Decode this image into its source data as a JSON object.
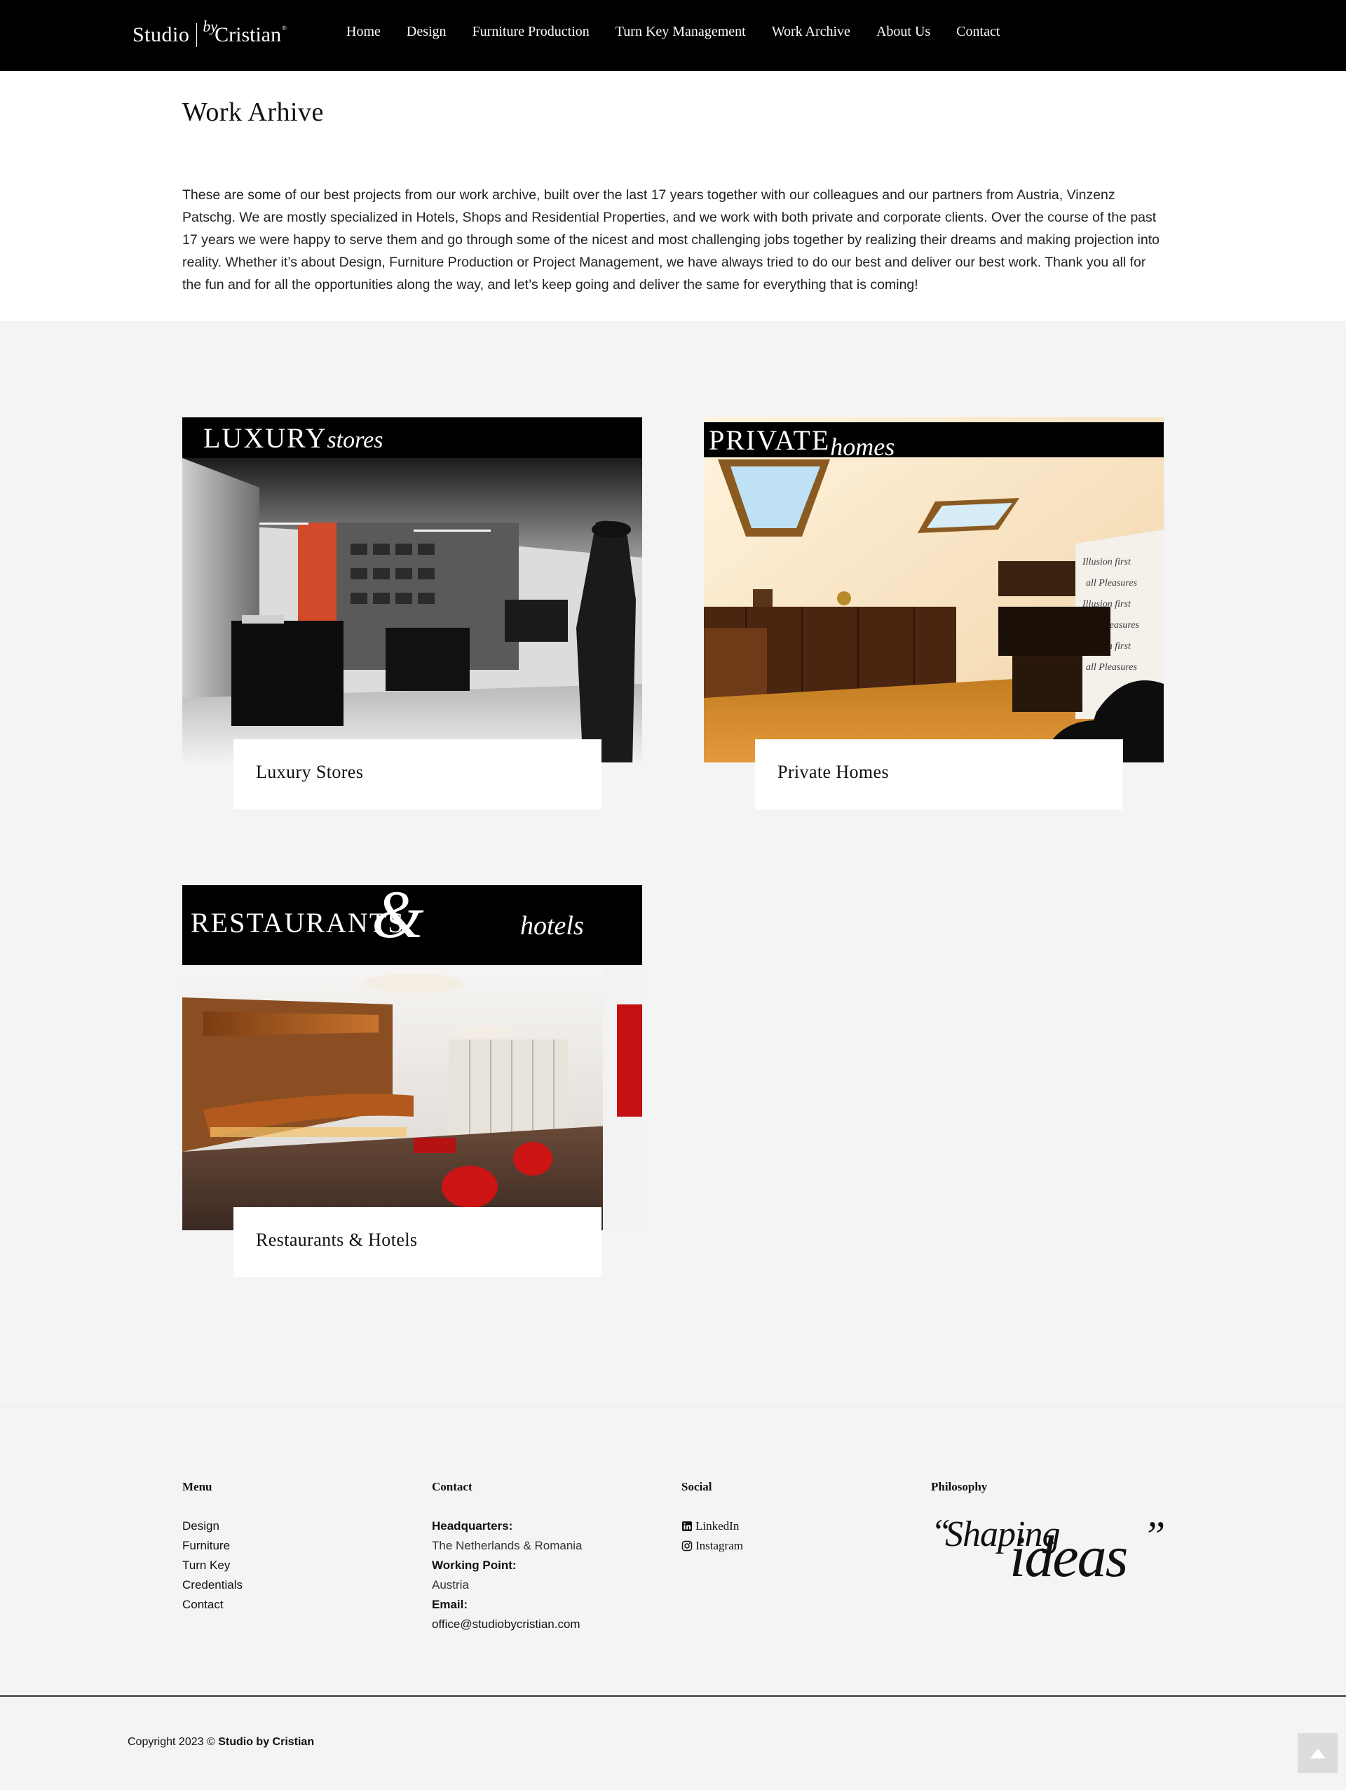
{
  "header": {
    "logo": {
      "studio": "Studio",
      "by": "by",
      "name": "Cristian",
      "reg": "®"
    },
    "nav": [
      "Home",
      "Design",
      "Furniture Production",
      "Turn Key Management",
      "Work Archive",
      "About Us",
      "Contact"
    ]
  },
  "intro": {
    "title": "Work Arhive",
    "text": "These are some of our best projects from our work archive, built over the last 17 years together with our colleagues and our partners from Austria, Vinzenz Patschg. We are mostly specialized in Hotels, Shops and Residential Properties, and we work with both private and corporate clients. Over the course of the past 17 years we were happy to serve them and go through some of the nicest and most challenging jobs together by realizing their dreams and making projection into reality. Whether it’s about Design, Furniture Production or Project Management, we have always tried to do our best and deliver our best work. Thank you all for the fun and for all the opportunities along the way, and let’s keep going and deliver the same for everything that is coming!"
  },
  "cards": [
    {
      "banner_main": "LUXURY",
      "banner_script": "stores",
      "caption": "Luxury Stores"
    },
    {
      "banner_main": "PRIVATE",
      "banner_script": "homes",
      "caption": "Private Homes"
    },
    {
      "banner_main": "RESTAURANTS",
      "banner_amp": "&",
      "banner_script": "hotels",
      "caption": "Restaurants & Hotels"
    }
  ],
  "footer": {
    "menu": {
      "title": "Menu",
      "items": [
        "Design",
        "Furniture",
        "Turn Key",
        "Credentials",
        "Contact"
      ]
    },
    "contact": {
      "title": "Contact",
      "hq_label": "Headquarters:",
      "hq_value": "The Netherlands & Romania",
      "wp_label": "Working Point:",
      "wp_value": "Austria",
      "email_label": "Email:",
      "email_value": "office@studiobycristian.com"
    },
    "social": {
      "title": "Social",
      "items": [
        {
          "label": "LinkedIn",
          "icon": "linkedin-icon"
        },
        {
          "label": "Instagram",
          "icon": "instagram-icon"
        }
      ]
    },
    "philosophy": {
      "title": "Philosophy",
      "word1": "Shaping",
      "word2": "ideas",
      "open_quote": "“",
      "close_quote": "”"
    }
  },
  "bottom": {
    "copyright_prefix": "Copyright 2023 ©",
    "copyright_name": "Studio by Cristian"
  },
  "colors": {
    "header_bg": "#000000",
    "gallery_bg": "#f4f4f4",
    "text": "#1a1a1a"
  }
}
